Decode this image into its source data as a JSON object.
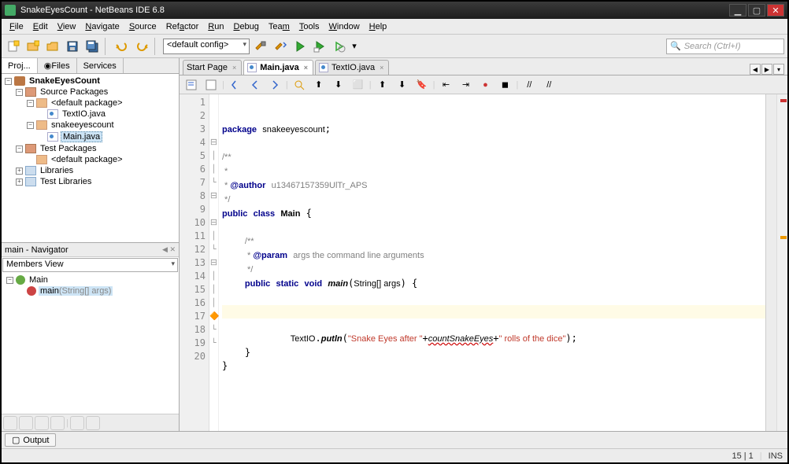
{
  "window": {
    "title": "SnakeEyesCount - NetBeans IDE 6.8"
  },
  "menu": [
    "File",
    "Edit",
    "View",
    "Navigate",
    "Source",
    "Refactor",
    "Run",
    "Debug",
    "Team",
    "Tools",
    "Window",
    "Help"
  ],
  "toolbar": {
    "config_selected": "<default config>",
    "search_placeholder": "Search (Ctrl+I)"
  },
  "left_tabs": [
    "Proj...",
    "Files",
    "Services"
  ],
  "project_tree": {
    "root": "SnakeEyesCount",
    "src": "Source Packages",
    "default_pkg": "<default package>",
    "textio": "TextIO.java",
    "pkg": "snakeeyescount",
    "main": "Main.java",
    "test": "Test Packages",
    "test_default": "<default package>",
    "libs": "Libraries",
    "test_libs": "Test Libraries"
  },
  "navigator": {
    "title": "main - Navigator",
    "view": "Members View",
    "class": "Main",
    "method": "main",
    "method_params": "(String[] args)"
  },
  "editor_tabs": [
    {
      "label": "Start Page",
      "active": false
    },
    {
      "label": "Main.java",
      "active": true
    },
    {
      "label": "TextIO.java",
      "active": false
    }
  ],
  "code": {
    "lines": 20,
    "package": "snakeeyescount",
    "author": "u13467157359UlTr_APS",
    "class": "Main",
    "param_doc": "args the command line arguments",
    "method": "main",
    "method_sig_args": "String[] args",
    "print_pre": "\"Snake Eyes after \"",
    "print_var": "countSnakeEyes",
    "print_post": "\" rolls of the dice\"",
    "textio_call": "TextIO",
    "putln": "putln"
  },
  "output_tab": "Output",
  "status": {
    "pos": "15 | 1",
    "mode": "INS"
  }
}
